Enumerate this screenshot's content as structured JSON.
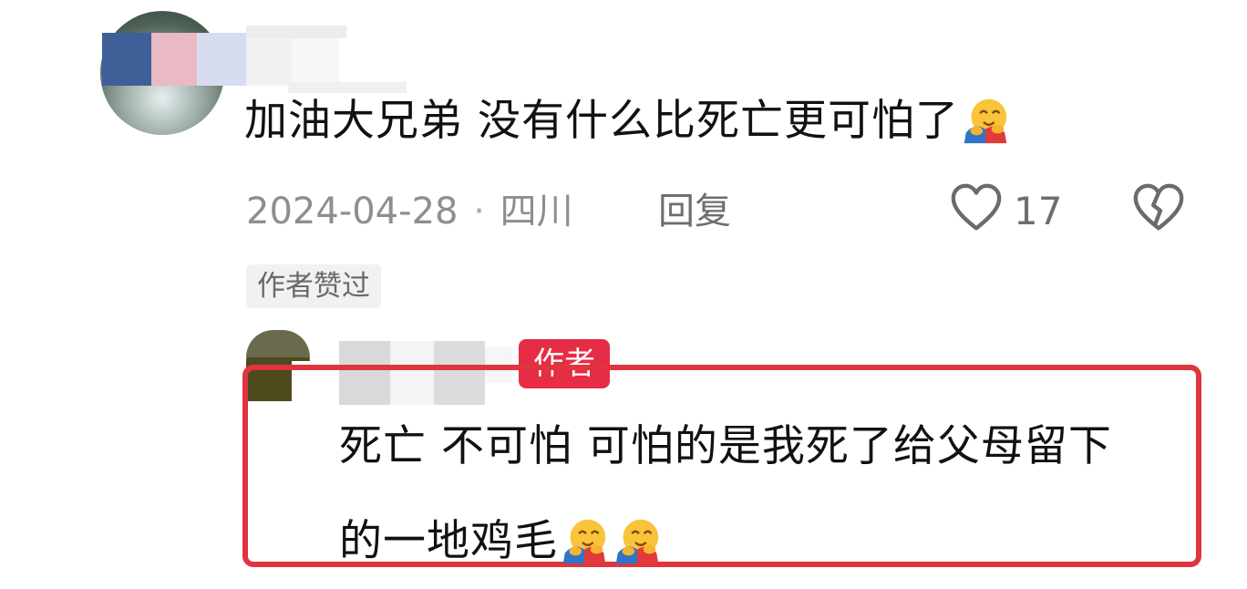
{
  "comment": {
    "text": "加油大兄弟 没有什么比死亡更可怕了",
    "emoji": "hugging-face-emoji",
    "date": "2024-04-28",
    "separator": "·",
    "location": "四川",
    "reply_label": "回复",
    "like_icon": "heart-outline-icon",
    "like_count": "17",
    "dislike_icon": "broken-heart-icon",
    "author_liked_badge": "作者赞过"
  },
  "reply": {
    "author_tag": "作者",
    "text_line1": "死亡 不可怕 可怕的是我死了给父母留下",
    "text_line2": "的一地鸡毛",
    "emojis": [
      "hugging-face-emoji",
      "hugging-face-emoji"
    ]
  },
  "colors": {
    "highlight_border": "#e0343e",
    "author_tag_bg": "#e62d45",
    "meta_text": "#8e8e8e"
  }
}
